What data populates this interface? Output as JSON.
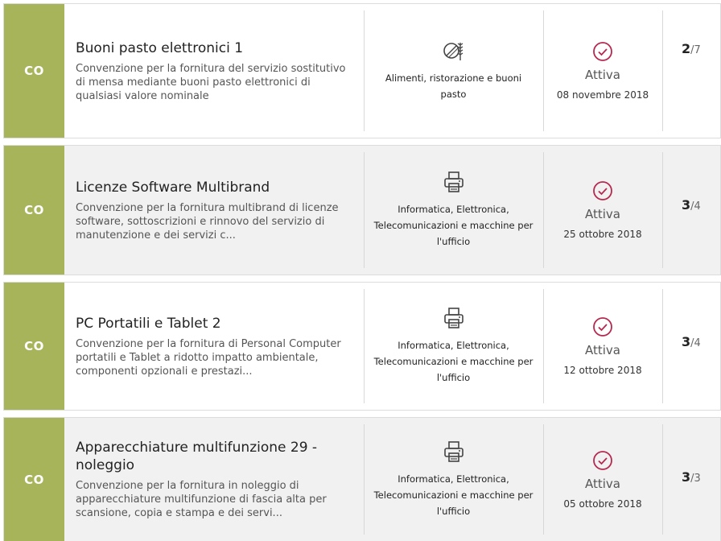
{
  "colors": {
    "badge": "#a7b45a",
    "status_icon": "#b5294e"
  },
  "items": [
    {
      "badge": "CO",
      "title": "Buoni pasto elettronici 1",
      "description": "Convenzione per la fornitura del servizio sostitutivo di mensa mediante buoni pasto elettronici di qualsiasi valore nominale",
      "category_icon": "food-wheat-icon",
      "category": "Alimenti, ristorazione e buoni pasto",
      "status": "Attiva",
      "date": "08 novembre 2018",
      "count_current": "2",
      "count_total": "/7"
    },
    {
      "badge": "CO",
      "title": "Licenze Software Multibrand",
      "description": "Convenzione per la fornitura multibrand di licenze software, sottoscrizioni e rinnovo del servizio di manutenzione e dei servizi c...",
      "category_icon": "printer-icon",
      "category": "Informatica, Elettronica, Telecomunicazioni e macchine per l'ufficio",
      "status": "Attiva",
      "date": "25 ottobre 2018",
      "count_current": "3",
      "count_total": "/4"
    },
    {
      "badge": "CO",
      "title": "PC Portatili e Tablet 2",
      "description": "Convenzione per la fornitura di Personal Computer portatili e Tablet a ridotto impatto ambientale, componenti opzionali e prestazi...",
      "category_icon": "printer-icon",
      "category": "Informatica, Elettronica, Telecomunicazioni e macchine per l'ufficio",
      "status": "Attiva",
      "date": "12 ottobre 2018",
      "count_current": "3",
      "count_total": "/4"
    },
    {
      "badge": "CO",
      "title": "Apparecchiature multifunzione 29 - noleggio",
      "description": "Convenzione per la fornitura in noleggio di apparecchiature multifunzione di fascia alta per scansione, copia e stampa e dei servi...",
      "category_icon": "printer-icon",
      "category": "Informatica, Elettronica, Telecomunicazioni e macchine per l'ufficio",
      "status": "Attiva",
      "date": "05 ottobre 2018",
      "count_current": "3",
      "count_total": "/3"
    }
  ]
}
